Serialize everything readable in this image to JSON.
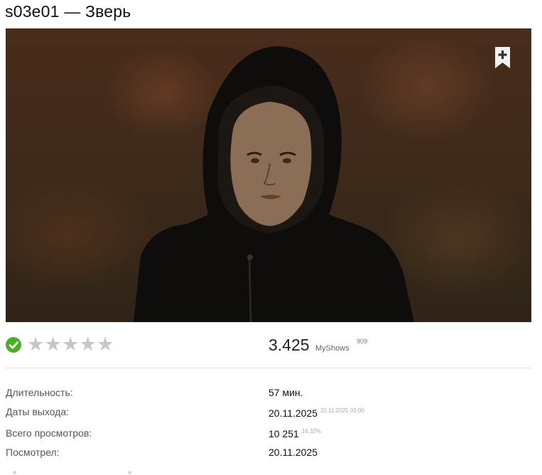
{
  "episode": {
    "title": "s03e01 — Зверь"
  },
  "still": {
    "alt": "Кадр из эпизода"
  },
  "bookmark": {
    "icon": "bookmark-plus-icon"
  },
  "watched": {
    "icon": "check-circle-icon",
    "color": "#4caf2a"
  },
  "user_rating": {
    "stars_total": 5,
    "stars_filled": 0,
    "star_glyph": "★"
  },
  "rating": {
    "value": "3.425",
    "source": "MyShows",
    "votes": "909"
  },
  "info": {
    "duration": {
      "label": "Длительность:",
      "value": "57 мин."
    },
    "release": {
      "label": "Даты выхода:",
      "value": "20.11.2025",
      "sub": "20.11.2025 03:00"
    },
    "views": {
      "label": "Всего просмотров:",
      "value": "10 251",
      "sub": "16.32%"
    },
    "watched_on": {
      "label": "Посмотрел:",
      "value": "20.11.2025"
    }
  }
}
